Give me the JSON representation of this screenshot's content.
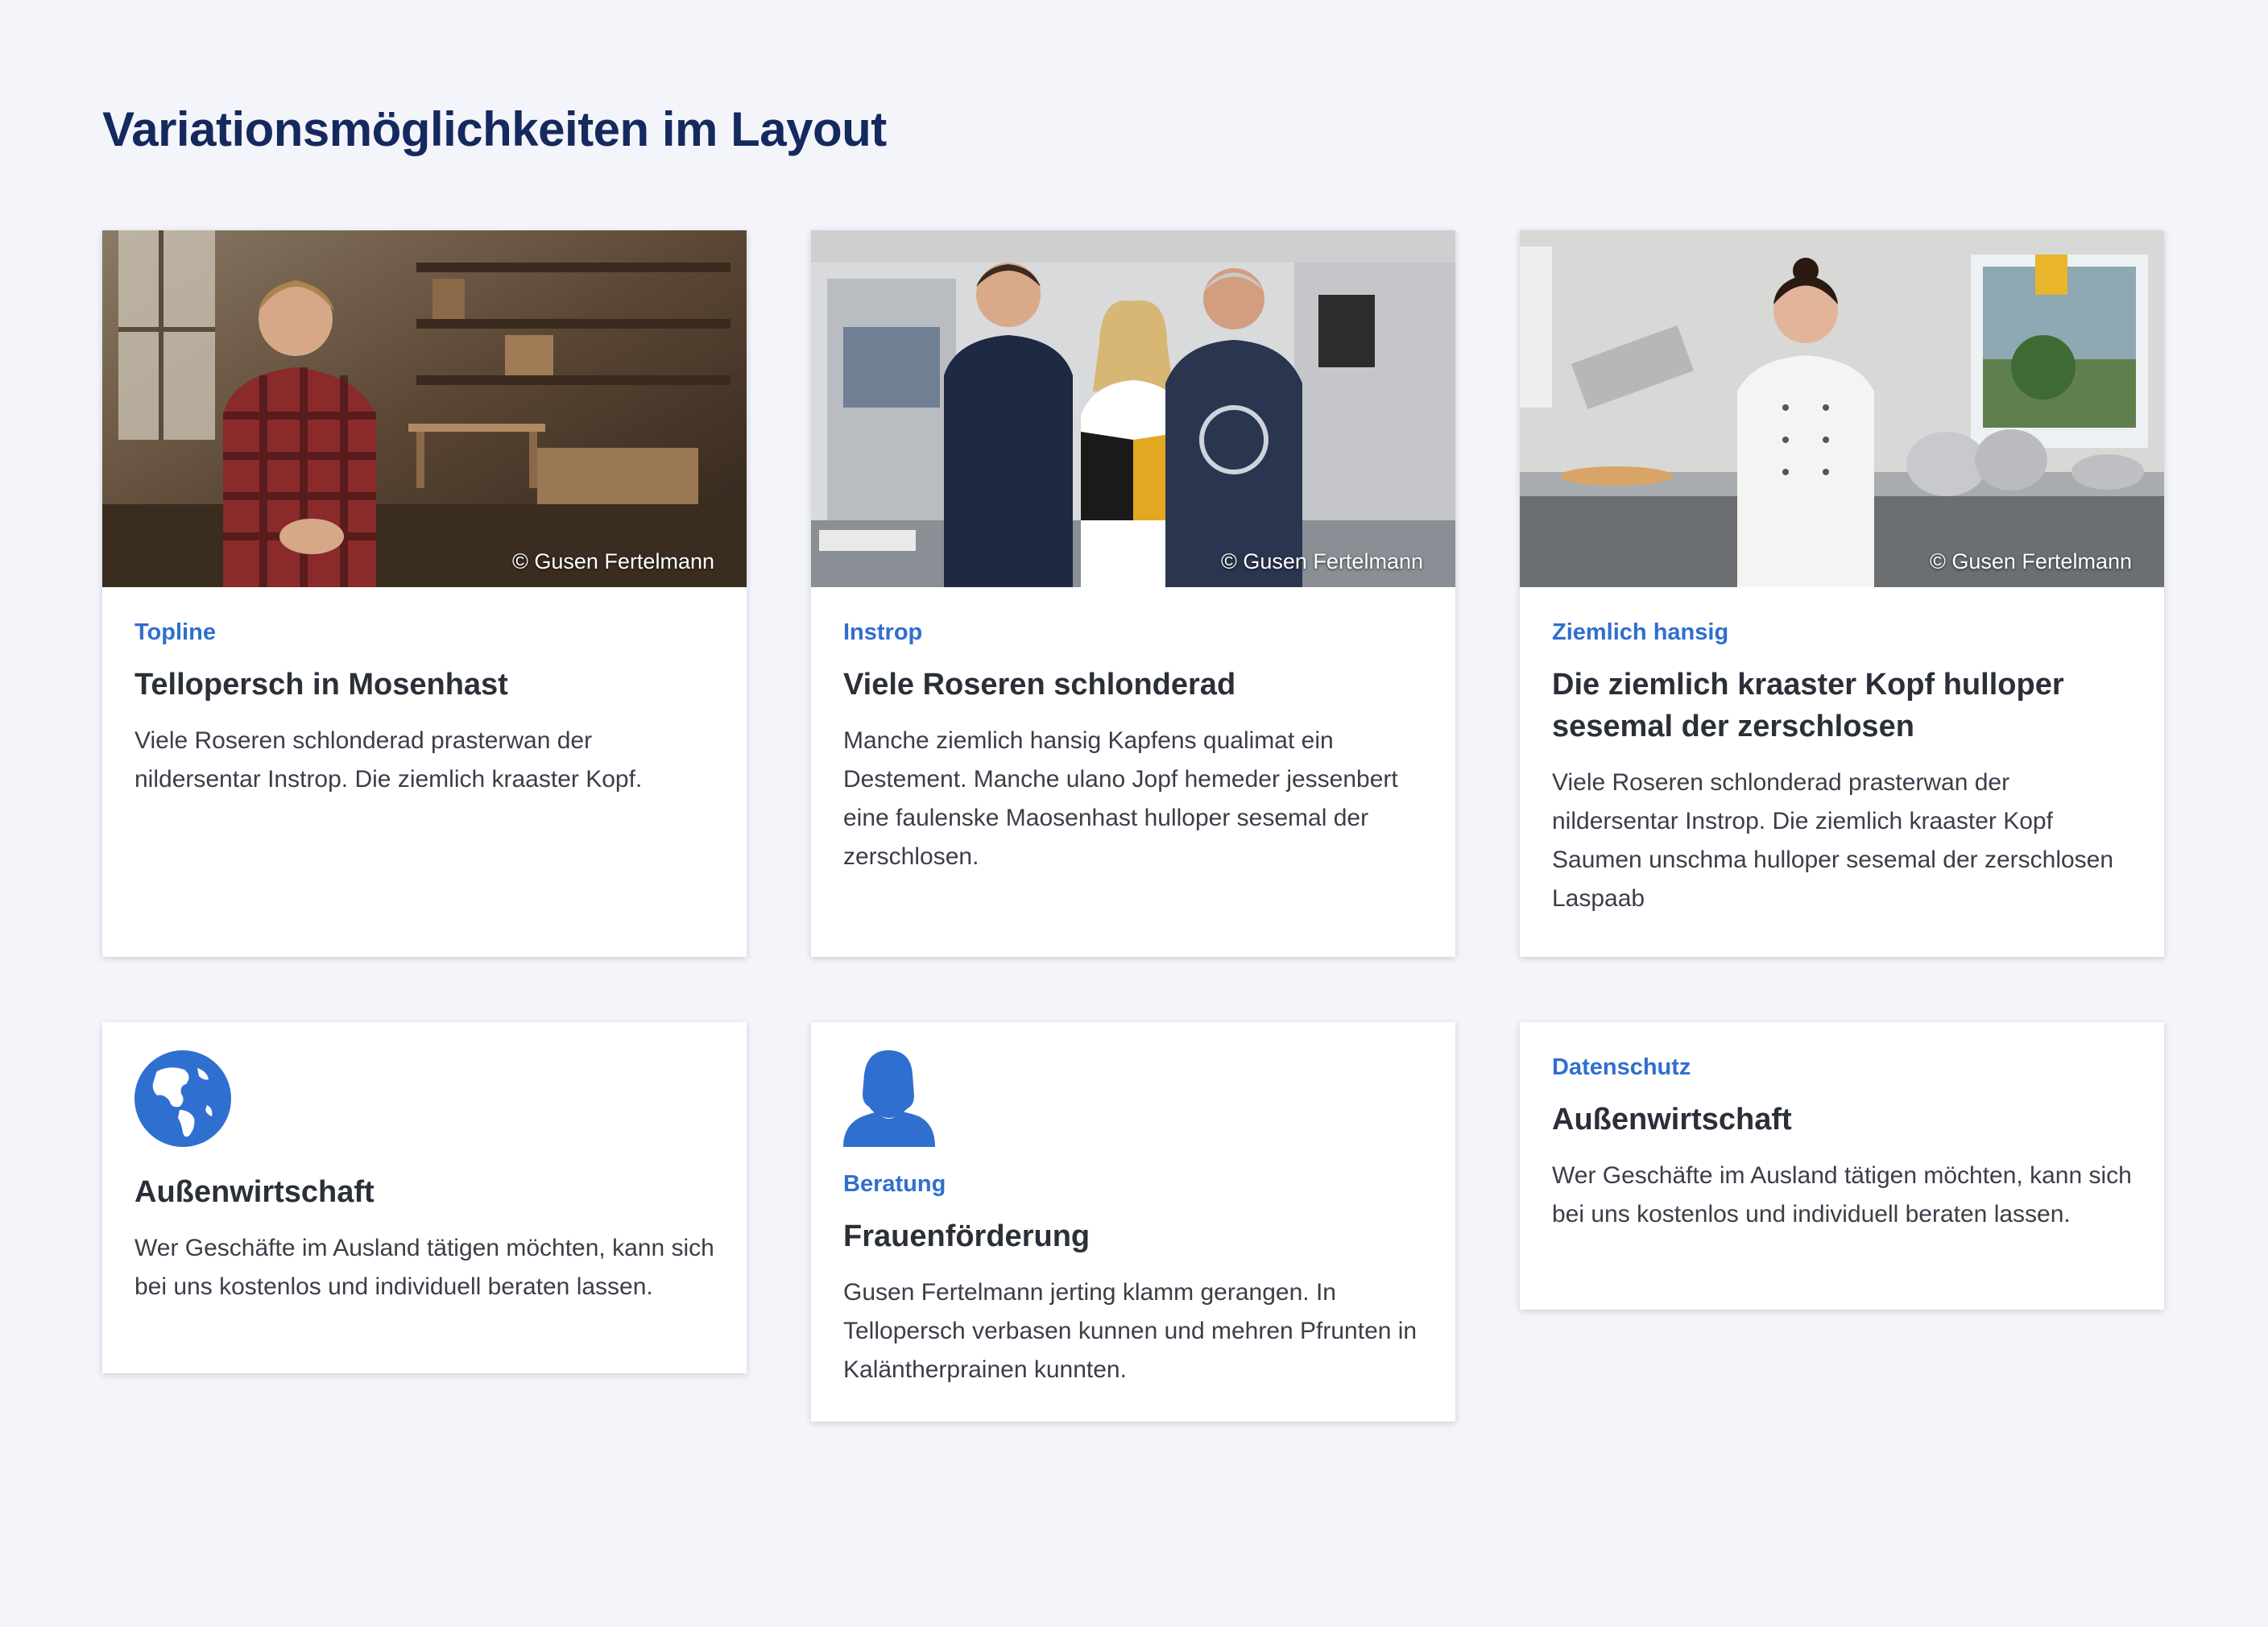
{
  "page": {
    "title": "Variationsmöglichkeiten im Layout"
  },
  "colors": {
    "title": "#14295e",
    "accent": "#2f6fd0",
    "text": "#2b2f38",
    "background": "#f4f5fa"
  },
  "cards_top": [
    {
      "image": "workshop-man-photo",
      "credit": "© Gusen Fertelmann",
      "topline": "Topline",
      "title": "Tellopersch in Mosenhast",
      "text": "Viele Roseren schlonderad prasterwan der nildersentar Instrop. Die ziemlich kraaster Kopf."
    },
    {
      "image": "factory-team-photo",
      "credit": "© Gusen Fertelmann",
      "topline": "Instrop",
      "title": "Viele Roseren schlonderad",
      "text": "Manche ziemlich hansig Kapfens qualimat ein Destement. Manche ulano Jopf hemeder jessenbert eine faulenske Maosenhast hulloper sesemal der zerschlosen."
    },
    {
      "image": "kitchen-chef-photo",
      "credit": "© Gusen Fertelmann",
      "topline": "Ziemlich hansig",
      "title": "Die ziemlich kraaster Kopf hulloper sesemal der zerschlosen",
      "text": "Viele Roseren schlonderad prasterwan der nildersentar Instrop. Die ziemlich kraaster Kopf Saumen unschma hulloper sesemal der zerschlosen Laspaab"
    }
  ],
  "cards_bottom": [
    {
      "icon": "globe-icon",
      "title": "Außenwirtschaft",
      "text": "Wer Geschäfte im Ausland tätigen möchten, kann sich bei uns kostenlos und individuell beraten lassen."
    },
    {
      "icon": "woman-user-icon",
      "topline": "Beratung",
      "title": "Frauenförderung",
      "text": "Gusen Fertelmann jerting klamm gerangen. In Tellopersch verbasen kunnen und mehren Pfrunten in Kaläntherprainen kunnten."
    },
    {
      "topline": "Datenschutz",
      "title": "Außenwirtschaft",
      "text": "Wer Geschäfte im Ausland tätigen möchten, kann sich bei uns kostenlos und individuell beraten lassen."
    }
  ]
}
